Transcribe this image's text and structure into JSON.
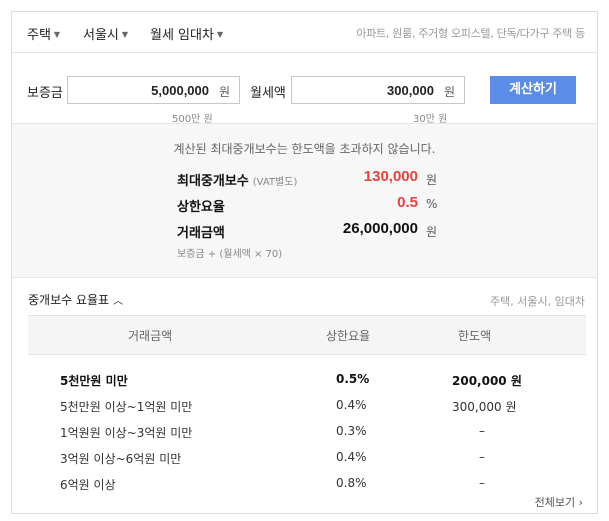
{
  "topbar": {
    "dropdowns": [
      "주택",
      "서울시",
      "월세 임대차"
    ],
    "right_text": "아파트, 원룸, 주거형 오피스텔, 단독/다가구 주택 등"
  },
  "calculator": {
    "deposit_label": "보증금",
    "deposit_value": "5,000,000",
    "deposit_unit": "원",
    "deposit_hint": "500만 원",
    "rent_label": "월세액",
    "rent_value": "300,000",
    "rent_unit": "원",
    "rent_hint": "30만 원",
    "button_label": "계산하기"
  },
  "result": {
    "note": "계산된 최대중개보수는 한도액을 초과하지 않습니다.",
    "max_fee_label": "최대중개보수",
    "max_fee_sub": "(VAT별도)",
    "max_fee_value": "130,000",
    "max_fee_unit": "원",
    "rate_label": "상한요율",
    "rate_value": "0.5",
    "rate_unit": "%",
    "amount_label": "거래금액",
    "amount_value": "26,000,000",
    "amount_unit": "원",
    "amount_formula": "보증금 + (월세액 × 70)",
    "accent_color": "#e8413c"
  },
  "fee_table": {
    "title": "중개보수 요율표",
    "right_text": "주택, 서울시, 임대차",
    "headers": [
      "거래금액",
      "상한요율",
      "한도액"
    ],
    "rows": [
      [
        "5천만원 미만",
        "0.5%",
        "200,000 원"
      ],
      [
        "5천만원 이상~1억원 미만",
        "0.4%",
        "300,000 원"
      ],
      [
        "1억원원 이상~3억원 미만",
        "0.3%",
        "–"
      ],
      [
        "3억원 이상~6억원 미만",
        "0.4%",
        "–"
      ],
      [
        "6억원 이상",
        "0.8%",
        "–"
      ]
    ],
    "more_label": "전체보기"
  },
  "button_color": "#5b8de8"
}
